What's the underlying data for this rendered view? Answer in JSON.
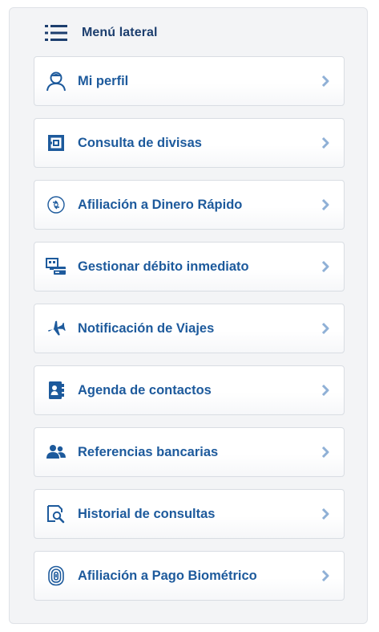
{
  "header": {
    "title": "Menú lateral",
    "icon": "menu-list-icon"
  },
  "colors": {
    "accent": "#1d5a9c",
    "title": "#1c3e6e",
    "chevron": "#8fb0d6",
    "panel_bg": "#f3f4f6"
  },
  "menu": {
    "items": [
      {
        "label": "Mi perfil",
        "icon": "user-profile-icon"
      },
      {
        "label": "Consulta de divisas",
        "icon": "currency-exchange-icon"
      },
      {
        "label": "Afiliación a Dinero Rápido",
        "icon": "quick-money-icon"
      },
      {
        "label": "Gestionar débito inmediato",
        "icon": "immediate-debit-icon"
      },
      {
        "label": "Notificación de Viajes",
        "icon": "airplane-icon"
      },
      {
        "label": "Agenda de contactos",
        "icon": "contacts-book-icon"
      },
      {
        "label": "Referencias bancarias",
        "icon": "people-icon"
      },
      {
        "label": "Historial de consultas",
        "icon": "search-history-icon"
      },
      {
        "label": "Afiliación a Pago Biométrico",
        "icon": "fingerprint-icon"
      }
    ]
  }
}
